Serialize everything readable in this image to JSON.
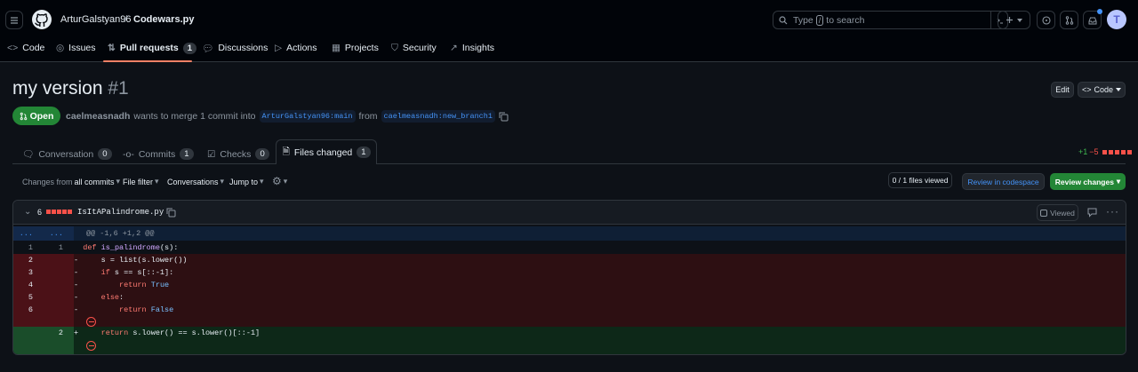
{
  "header": {
    "owner": "ArturGalstyan96",
    "separator": "/",
    "repo": "Codewars.py",
    "search_placeholder_before": "Type",
    "search_key": "/",
    "search_placeholder_after": "to search",
    "avatar_initial": "T"
  },
  "nav": {
    "items": [
      {
        "label": "Code"
      },
      {
        "label": "Issues"
      },
      {
        "label": "Pull requests",
        "count": "1"
      },
      {
        "label": "Discussions"
      },
      {
        "label": "Actions"
      },
      {
        "label": "Projects"
      },
      {
        "label": "Security"
      },
      {
        "label": "Insights"
      }
    ]
  },
  "pr": {
    "title": "my version",
    "number": "#1",
    "edit_label": "Edit",
    "code_label": "Code",
    "state": "Open",
    "author": "caelmeasnadh",
    "merge_text_1": "wants to merge 1 commit into",
    "base_branch": "ArturGalstyan96:main",
    "merge_text_2": "from",
    "head_branch": "caelmeasnadh:new_branch1"
  },
  "tabs": [
    {
      "label": "Conversation",
      "count": "0"
    },
    {
      "label": "Commits",
      "count": "1"
    },
    {
      "label": "Checks",
      "count": "0"
    },
    {
      "label": "Files changed",
      "count": "1"
    }
  ],
  "diffstat": {
    "additions": "+1",
    "deletions": "−5"
  },
  "toolbar": {
    "changes_from_prefix": "Changes from",
    "changes_from_value": "all commits",
    "file_filter": "File filter",
    "conversations": "Conversations",
    "jump_to": "Jump to",
    "files_viewed": "0 / 1 files viewed",
    "review_codespace": "Review in codespace",
    "review_changes": "Review changes"
  },
  "file": {
    "change_count": "6",
    "name": "IsItAPalindrome.py",
    "viewed_label": "Viewed",
    "hunk_left": "...",
    "hunk_right": "...",
    "hunk_header": "@@ -1,6 +1,2 @@",
    "lines": [
      {
        "type": "ctx",
        "old": "1",
        "new": "1",
        "sign": " ",
        "text": "def is_palindrome(s):"
      },
      {
        "type": "del",
        "old": "2",
        "new": "",
        "sign": "-",
        "text": "    s = list(s.lower())"
      },
      {
        "type": "del",
        "old": "3",
        "new": "",
        "sign": "-",
        "text": "    if s == s[::-1]:"
      },
      {
        "type": "del",
        "old": "4",
        "new": "",
        "sign": "-",
        "text": "        return True"
      },
      {
        "type": "del",
        "old": "5",
        "new": "",
        "sign": "-",
        "text": "    else:"
      },
      {
        "type": "del",
        "old": "6",
        "new": "",
        "sign": "-",
        "text": "        return False"
      },
      {
        "type": "add",
        "old": "",
        "new": "2",
        "sign": "+",
        "text": "    return s.lower() == s.lower()[::-1]"
      }
    ]
  },
  "colors": {
    "background": "#0d1117",
    "header_bg": "#010409",
    "accent_green": "#238636",
    "link_blue": "#4493f8",
    "deletion_red": "#f85149",
    "addition_green": "#3fb950",
    "nav_underline": "#f78166"
  }
}
